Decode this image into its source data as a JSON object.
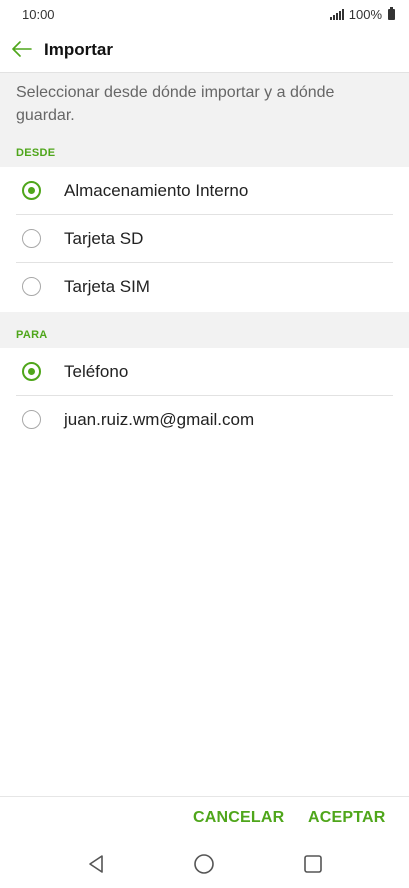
{
  "status": {
    "time": "10:00",
    "battery": "100%"
  },
  "header": {
    "title": "Importar",
    "back_icon": "arrow-left-icon"
  },
  "description": "Seleccionar desde dónde importar y a dónde guardar.",
  "sections": {
    "desde": {
      "title": "DESDE",
      "options": [
        {
          "label": "Almacenamiento Interno",
          "selected": true
        },
        {
          "label": "Tarjeta SD",
          "selected": false
        },
        {
          "label": "Tarjeta SIM",
          "selected": false
        }
      ]
    },
    "para": {
      "title": "PARA",
      "options": [
        {
          "label": "Teléfono",
          "selected": true
        },
        {
          "label": "juan.ruiz.wm@gmail.com",
          "selected": false
        }
      ]
    }
  },
  "footer": {
    "cancel": "CANCELAR",
    "accept": "ACEPTAR"
  },
  "colors": {
    "accent": "#4fa61b",
    "section_bg": "#f2f2f2"
  }
}
